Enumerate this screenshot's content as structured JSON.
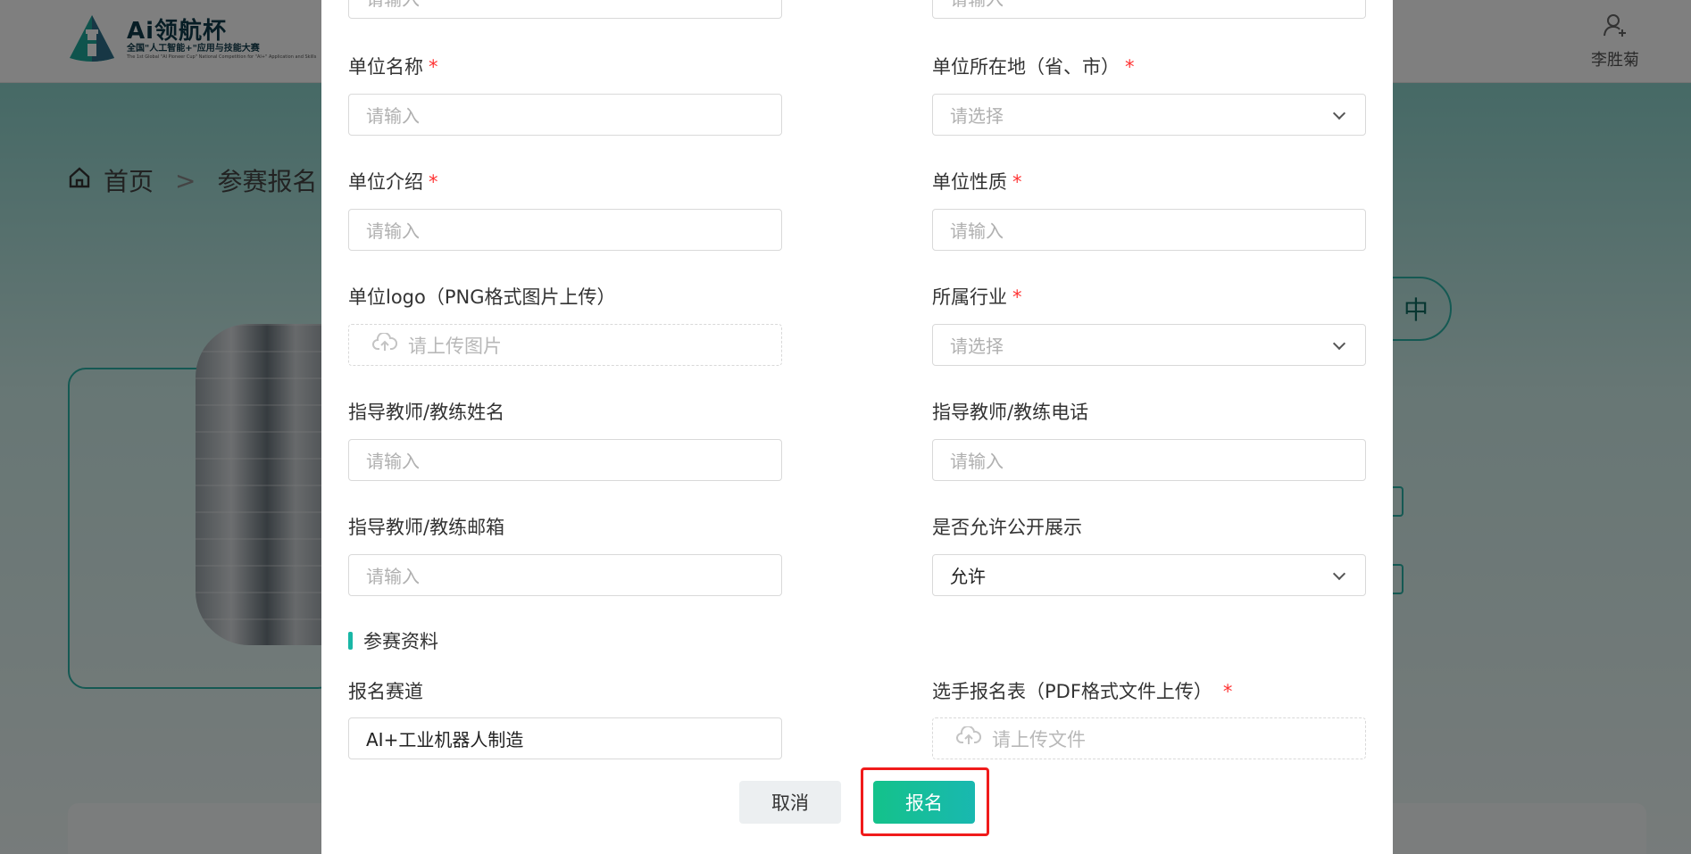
{
  "header": {
    "logo_title": "Ai领航杯",
    "logo_subtitle": "全国\"人工智能+\"应用与技能大赛",
    "logo_subtitle_en": "The 1st Global \"AI Pioneer Cup\" National Competition for \"AI+\" Application and Skills",
    "user_name": "李胜菊"
  },
  "background": {
    "breadcrumb_home": "首页",
    "breadcrumb_separator": ">",
    "breadcrumb_current": "参赛报名",
    "status_pill": "中"
  },
  "form": {
    "top_left_placeholder": "请输入",
    "top_right_placeholder": "请输入",
    "unit_name": {
      "label": "单位名称",
      "placeholder": "请输入"
    },
    "unit_location": {
      "label": "单位所在地（省、市）",
      "placeholder": "请选择"
    },
    "unit_intro": {
      "label": "单位介绍",
      "placeholder": "请输入"
    },
    "unit_nature": {
      "label": "单位性质",
      "placeholder": "请输入"
    },
    "unit_logo": {
      "label": "单位logo（PNG格式图片上传）",
      "upload_text": "请上传图片"
    },
    "industry": {
      "label": "所属行业",
      "placeholder": "请选择"
    },
    "coach_name": {
      "label": "指导教师/教练姓名",
      "placeholder": "请输入"
    },
    "coach_phone": {
      "label": "指导教师/教练电话",
      "placeholder": "请输入"
    },
    "coach_email": {
      "label": "指导教师/教练邮箱",
      "placeholder": "请输入"
    },
    "public_display": {
      "label": "是否允许公开展示",
      "value": "允许"
    },
    "section_title": "参赛资料",
    "track": {
      "label": "报名赛道",
      "value": "AI+工业机器人制造"
    },
    "signup_form": {
      "label": "选手报名表（PDF格式文件上传）",
      "upload_text": "请上传文件"
    },
    "required_mark": "*"
  },
  "buttons": {
    "cancel": "取消",
    "submit": "报名"
  },
  "colors": {
    "accent": "#19b7a6",
    "required": "#ff3333",
    "highlight": "#f01b1b"
  }
}
